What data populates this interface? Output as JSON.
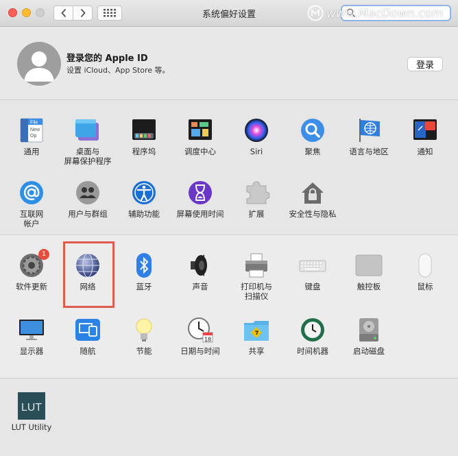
{
  "window": {
    "title": "系统偏好设置"
  },
  "search": {
    "value": "",
    "placeholder": ""
  },
  "watermark": {
    "text": "www.MacDown.com"
  },
  "account": {
    "title": "登录您的 Apple ID",
    "subtitle": "设置 iCloud、App Store 等。",
    "login_label": "登录"
  },
  "section1": {
    "items": [
      {
        "label": "通用"
      },
      {
        "label": "桌面与\n屏幕保护程序"
      },
      {
        "label": "程序坞"
      },
      {
        "label": "调度中心"
      },
      {
        "label": "Siri"
      },
      {
        "label": "聚焦"
      },
      {
        "label": "语言与地区"
      },
      {
        "label": "通知"
      },
      {
        "label": "互联网\n帐户"
      },
      {
        "label": "用户与群组"
      },
      {
        "label": "辅助功能"
      },
      {
        "label": "屏幕使用时间"
      },
      {
        "label": "扩展"
      },
      {
        "label": "安全性与隐私"
      }
    ],
    "general_icon_text": "File\nNew\nOp"
  },
  "section2": {
    "items": [
      {
        "label": "软件更新",
        "badge": "1"
      },
      {
        "label": "网络"
      },
      {
        "label": "蓝牙"
      },
      {
        "label": "声音"
      },
      {
        "label": "打印机与\n扫描仪"
      },
      {
        "label": "键盘"
      },
      {
        "label": "触控板"
      },
      {
        "label": "鼠标"
      },
      {
        "label": "显示器"
      },
      {
        "label": "随航"
      },
      {
        "label": "节能"
      },
      {
        "label": "日期与时间"
      },
      {
        "label": "共享"
      },
      {
        "label": "时间机器"
      },
      {
        "label": "启动磁盘"
      }
    ],
    "calendar_day": "18"
  },
  "section3": {
    "items": [
      {
        "label": "LUT Utility",
        "icon_text": "LUT"
      }
    ]
  },
  "colors": {
    "highlight": "#e05a4e",
    "badge": "#e94b3c",
    "accent": "#1a73e8"
  }
}
